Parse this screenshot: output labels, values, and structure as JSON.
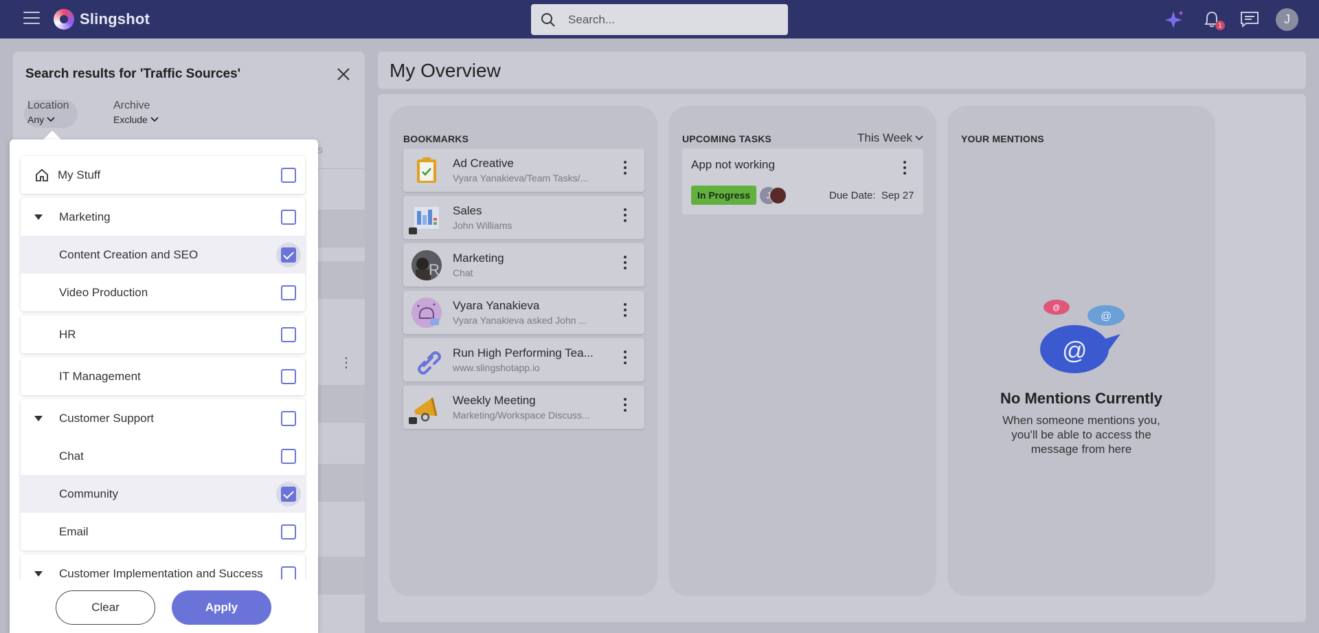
{
  "topbar": {
    "app_name": "Slingshot",
    "search_placeholder": "Search...",
    "notification_count": "1",
    "user_initial": "J"
  },
  "search_panel": {
    "title": "Search results for 'Traffic Sources'",
    "filters": [
      {
        "label": "Location",
        "value": "Any"
      },
      {
        "label": "Archive",
        "value": "Exclude"
      }
    ],
    "ghost_text": "s"
  },
  "location_dropdown": {
    "groups": [
      {
        "rows": [
          {
            "label": "My Stuff",
            "checked": false,
            "icon": "home-icon"
          }
        ]
      },
      {
        "rows": [
          {
            "label": "Marketing",
            "checked": false,
            "expandable": true
          },
          {
            "label": "Content Creation and SEO",
            "checked": true
          },
          {
            "label": "Video Production",
            "checked": false
          }
        ]
      },
      {
        "rows": [
          {
            "label": "HR",
            "checked": false
          }
        ]
      },
      {
        "rows": [
          {
            "label": "IT Management",
            "checked": false
          }
        ]
      },
      {
        "rows": [
          {
            "label": "Customer Support",
            "checked": false,
            "expandable": true
          },
          {
            "label": "Chat",
            "checked": false
          },
          {
            "label": "Community",
            "checked": true
          },
          {
            "label": "Email",
            "checked": false
          }
        ]
      },
      {
        "rows": [
          {
            "label": "Customer Implementation and Success",
            "checked": false,
            "expandable": true
          }
        ]
      }
    ],
    "clear_label": "Clear",
    "apply_label": "Apply"
  },
  "overview": {
    "title": "My Overview",
    "bookmarks": {
      "title": "BOOKMARKS",
      "items": [
        {
          "title": "Ad Creative",
          "subtitle": "Vyara Yanakieva/Team Tasks/...",
          "icon": "clipboard-check-icon"
        },
        {
          "title": "Sales",
          "subtitle": "John Williams",
          "icon": "dashboard-thumbnail-icon"
        },
        {
          "title": "Marketing",
          "subtitle": "Chat",
          "icon": "channel-avatar-icon"
        },
        {
          "title": "Vyara Yanakieva",
          "subtitle": "Vyara Yanakieva asked John ...",
          "icon": "chat-bubble-avatar-icon"
        },
        {
          "title": "Run High Performing Tea...",
          "subtitle": "www.slingshotapp.io",
          "icon": "link-icon"
        },
        {
          "title": "Weekly Meeting",
          "subtitle": "Marketing/Workspace Discuss...",
          "icon": "megaphone-icon"
        }
      ]
    },
    "tasks": {
      "title": "UPCOMING TASKS",
      "range": "This Week",
      "items": [
        {
          "title": "App not working",
          "status": "In Progress",
          "assignee_initial": "J",
          "due_label": "Due Date:",
          "due_date": "Sep 27"
        }
      ]
    },
    "mentions": {
      "title": "YOUR MENTIONS",
      "empty_title": "No Mentions Currently",
      "empty_text": "When someone mentions you, you'll be able to access the message from here"
    }
  },
  "colors": {
    "topbar": "#2e3369",
    "accent": "#6a74d8",
    "status_green": "#62b140"
  }
}
